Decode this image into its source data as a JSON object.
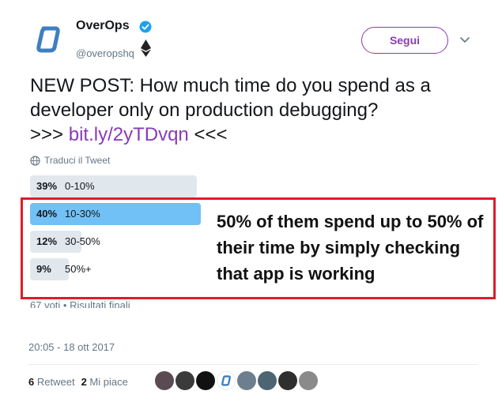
{
  "account": {
    "name": "OverOps",
    "handle": "@overopshq",
    "follow_label": "Segui",
    "brand_color": "#8a3ab9"
  },
  "tweet": {
    "text": "NEW POST: How much time do you spend as a developer only on production debugging?",
    "link_prefix": ">>>",
    "link": "bit.ly/2yTDvqn",
    "link_suffix": "<<<",
    "translate_label": "Traduci il Tweet"
  },
  "poll": {
    "options": [
      {
        "pct": "39%",
        "label": "0-10%",
        "value": 39,
        "leading": false
      },
      {
        "pct": "40%",
        "label": "10-30%",
        "value": 40,
        "leading": true
      },
      {
        "pct": "12%",
        "label": "30-50%",
        "value": 12,
        "leading": false
      },
      {
        "pct": "9%",
        "label": "50%+",
        "value": 9,
        "leading": false
      }
    ],
    "meta": "67 voti • Risultati finali",
    "leading_color": "#71c1f6",
    "other_color": "#e1e8ed"
  },
  "annotation": {
    "text": "50% of them spend up to 50% of their time by simply checking that app is working",
    "border_color": "#e01b2a"
  },
  "timestamp": "20:05 - 18 ott 2017",
  "stats": {
    "retweets_count": "6",
    "retweets_label": "Retweet",
    "likes_count": "2",
    "likes_label": "Mi piace"
  },
  "icons": {
    "verified": "verified-badge-icon",
    "ethereum": "ethereum-icon",
    "caret": "chevron-down-icon",
    "globe": "globe-icon"
  }
}
